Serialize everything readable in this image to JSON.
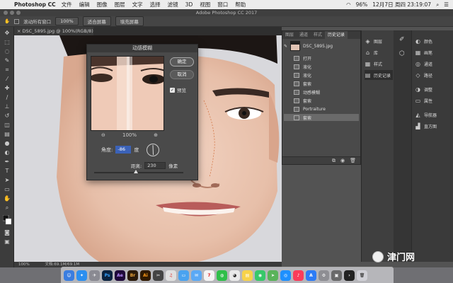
{
  "menubar": {
    "app": "Photoshop CC",
    "items": [
      "文件",
      "编辑",
      "图像",
      "图层",
      "文字",
      "选择",
      "滤镜",
      "3D",
      "视图",
      "窗口",
      "帮助"
    ],
    "battery": "96%",
    "datetime": "12月7日 周四 23:19:07"
  },
  "window": {
    "title": "Adobe Photoshop CC 2017"
  },
  "options": {
    "scroll_all": "滚动所有窗口",
    "zoom": "100%",
    "fit_screen": "适合屏幕",
    "fill_screen": "填充屏幕"
  },
  "document": {
    "tab": "DSC_5895.jpg @ 100%(RGB/8)",
    "status": "文档:69.1M/69.1M",
    "zoom_status": "100%"
  },
  "dialog": {
    "title": "动感模糊",
    "ok": "确定",
    "cancel": "取消",
    "preview": "预览",
    "preview_checked": true,
    "zoom": "100%",
    "angle_label": "角度:",
    "angle_value": "-86",
    "angle_unit": "度",
    "distance_label": "距离:",
    "distance_value": "230",
    "distance_unit": "像素",
    "zoom_out": "⊖",
    "zoom_in": "⊕"
  },
  "history": {
    "tabs": [
      "图层",
      "通道",
      "样式",
      "历史记录"
    ],
    "active_tab": 3,
    "snapshot": "DSC_5895.jpg",
    "steps": [
      "打开",
      "液化",
      "液化",
      "套索",
      "动感模糊",
      "套索",
      "Portraiture",
      "套索"
    ],
    "selected_step": 7
  },
  "dock1": [
    {
      "icon": "layers-icon",
      "label": "图层"
    },
    {
      "icon": "library-icon",
      "label": "库"
    },
    {
      "icon": "styles-icon",
      "label": "样式"
    },
    {
      "icon": "history-icon",
      "label": "历史记录"
    }
  ],
  "dock2": [
    {
      "icon": "color-icon",
      "label": "颜色"
    },
    {
      "icon": "swatches-icon",
      "label": "画笔"
    },
    {
      "icon": "channels-icon",
      "label": "通道"
    },
    {
      "icon": "paths-icon",
      "label": "路径"
    },
    {
      "icon": "adjustments-icon",
      "label": "调整"
    },
    {
      "icon": "properties-icon",
      "label": "属性"
    },
    {
      "icon": "navigator-icon",
      "label": "导航器"
    },
    {
      "icon": "histogram-icon",
      "label": "直方图"
    }
  ],
  "watermark": "津门网",
  "dock_apps": [
    "Finder",
    "Safari",
    "Launchpad",
    "Ps",
    "Ae",
    "Br",
    "Ai",
    "Cut",
    "Music",
    "Files",
    "Mail",
    "Calendar",
    "WeChat",
    "QQ",
    "Notes",
    "App",
    "Maps",
    "Safari2",
    "Music2",
    "Store",
    "Prefs",
    "Image",
    "Terminal",
    "Trash"
  ]
}
